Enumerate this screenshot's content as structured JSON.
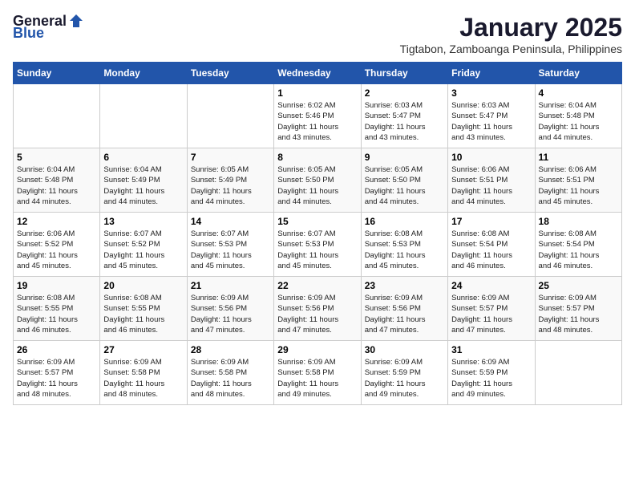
{
  "header": {
    "logo_general": "General",
    "logo_blue": "Blue",
    "month": "January 2025",
    "location": "Tigtabon, Zamboanga Peninsula, Philippines"
  },
  "weekdays": [
    "Sunday",
    "Monday",
    "Tuesday",
    "Wednesday",
    "Thursday",
    "Friday",
    "Saturday"
  ],
  "weeks": [
    [
      {
        "day": "",
        "info": ""
      },
      {
        "day": "",
        "info": ""
      },
      {
        "day": "",
        "info": ""
      },
      {
        "day": "1",
        "info": "Sunrise: 6:02 AM\nSunset: 5:46 PM\nDaylight: 11 hours\nand 43 minutes."
      },
      {
        "day": "2",
        "info": "Sunrise: 6:03 AM\nSunset: 5:47 PM\nDaylight: 11 hours\nand 43 minutes."
      },
      {
        "day": "3",
        "info": "Sunrise: 6:03 AM\nSunset: 5:47 PM\nDaylight: 11 hours\nand 43 minutes."
      },
      {
        "day": "4",
        "info": "Sunrise: 6:04 AM\nSunset: 5:48 PM\nDaylight: 11 hours\nand 44 minutes."
      }
    ],
    [
      {
        "day": "5",
        "info": "Sunrise: 6:04 AM\nSunset: 5:48 PM\nDaylight: 11 hours\nand 44 minutes."
      },
      {
        "day": "6",
        "info": "Sunrise: 6:04 AM\nSunset: 5:49 PM\nDaylight: 11 hours\nand 44 minutes."
      },
      {
        "day": "7",
        "info": "Sunrise: 6:05 AM\nSunset: 5:49 PM\nDaylight: 11 hours\nand 44 minutes."
      },
      {
        "day": "8",
        "info": "Sunrise: 6:05 AM\nSunset: 5:50 PM\nDaylight: 11 hours\nand 44 minutes."
      },
      {
        "day": "9",
        "info": "Sunrise: 6:05 AM\nSunset: 5:50 PM\nDaylight: 11 hours\nand 44 minutes."
      },
      {
        "day": "10",
        "info": "Sunrise: 6:06 AM\nSunset: 5:51 PM\nDaylight: 11 hours\nand 44 minutes."
      },
      {
        "day": "11",
        "info": "Sunrise: 6:06 AM\nSunset: 5:51 PM\nDaylight: 11 hours\nand 45 minutes."
      }
    ],
    [
      {
        "day": "12",
        "info": "Sunrise: 6:06 AM\nSunset: 5:52 PM\nDaylight: 11 hours\nand 45 minutes."
      },
      {
        "day": "13",
        "info": "Sunrise: 6:07 AM\nSunset: 5:52 PM\nDaylight: 11 hours\nand 45 minutes."
      },
      {
        "day": "14",
        "info": "Sunrise: 6:07 AM\nSunset: 5:53 PM\nDaylight: 11 hours\nand 45 minutes."
      },
      {
        "day": "15",
        "info": "Sunrise: 6:07 AM\nSunset: 5:53 PM\nDaylight: 11 hours\nand 45 minutes."
      },
      {
        "day": "16",
        "info": "Sunrise: 6:08 AM\nSunset: 5:53 PM\nDaylight: 11 hours\nand 45 minutes."
      },
      {
        "day": "17",
        "info": "Sunrise: 6:08 AM\nSunset: 5:54 PM\nDaylight: 11 hours\nand 46 minutes."
      },
      {
        "day": "18",
        "info": "Sunrise: 6:08 AM\nSunset: 5:54 PM\nDaylight: 11 hours\nand 46 minutes."
      }
    ],
    [
      {
        "day": "19",
        "info": "Sunrise: 6:08 AM\nSunset: 5:55 PM\nDaylight: 11 hours\nand 46 minutes."
      },
      {
        "day": "20",
        "info": "Sunrise: 6:08 AM\nSunset: 5:55 PM\nDaylight: 11 hours\nand 46 minutes."
      },
      {
        "day": "21",
        "info": "Sunrise: 6:09 AM\nSunset: 5:56 PM\nDaylight: 11 hours\nand 47 minutes."
      },
      {
        "day": "22",
        "info": "Sunrise: 6:09 AM\nSunset: 5:56 PM\nDaylight: 11 hours\nand 47 minutes."
      },
      {
        "day": "23",
        "info": "Sunrise: 6:09 AM\nSunset: 5:56 PM\nDaylight: 11 hours\nand 47 minutes."
      },
      {
        "day": "24",
        "info": "Sunrise: 6:09 AM\nSunset: 5:57 PM\nDaylight: 11 hours\nand 47 minutes."
      },
      {
        "day": "25",
        "info": "Sunrise: 6:09 AM\nSunset: 5:57 PM\nDaylight: 11 hours\nand 48 minutes."
      }
    ],
    [
      {
        "day": "26",
        "info": "Sunrise: 6:09 AM\nSunset: 5:57 PM\nDaylight: 11 hours\nand 48 minutes."
      },
      {
        "day": "27",
        "info": "Sunrise: 6:09 AM\nSunset: 5:58 PM\nDaylight: 11 hours\nand 48 minutes."
      },
      {
        "day": "28",
        "info": "Sunrise: 6:09 AM\nSunset: 5:58 PM\nDaylight: 11 hours\nand 48 minutes."
      },
      {
        "day": "29",
        "info": "Sunrise: 6:09 AM\nSunset: 5:58 PM\nDaylight: 11 hours\nand 49 minutes."
      },
      {
        "day": "30",
        "info": "Sunrise: 6:09 AM\nSunset: 5:59 PM\nDaylight: 11 hours\nand 49 minutes."
      },
      {
        "day": "31",
        "info": "Sunrise: 6:09 AM\nSunset: 5:59 PM\nDaylight: 11 hours\nand 49 minutes."
      },
      {
        "day": "",
        "info": ""
      }
    ]
  ]
}
